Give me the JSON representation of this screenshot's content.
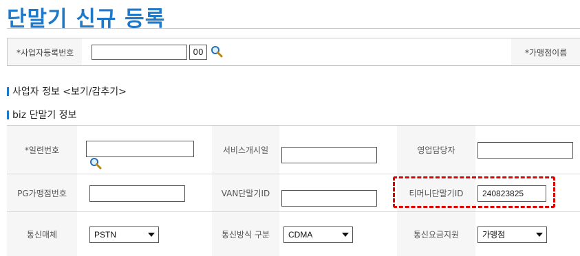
{
  "page": {
    "title": "단말기 신규 등록"
  },
  "search": {
    "biz_no_label": "*사업자등록번호",
    "biz_no_value": "",
    "biz_no_suffix": "00",
    "merchant_name_label": "*가맹점이름"
  },
  "sections": {
    "business_info": "사업자 정보 <보기/감추기>",
    "terminal_info": "biz 단말기 정보"
  },
  "terminal": {
    "serial_no": {
      "label": "*일련번호",
      "value": ""
    },
    "service_start": {
      "label": "서비스개시일",
      "value": ""
    },
    "sales_manager": {
      "label": "영업담당자",
      "value": ""
    },
    "pg_merchant_no": {
      "label": "PG가맹점번호",
      "value": ""
    },
    "van_terminal_id": {
      "label": "VAN단말기ID",
      "value": ""
    },
    "tmoney_terminal_id": {
      "label": "티머니단말기ID",
      "value": "240823825"
    },
    "comm_medium": {
      "label": "통신매체",
      "selected": "PSTN"
    },
    "comm_method": {
      "label": "통신방식 구분",
      "selected": "CDMA"
    },
    "comm_fee_support": {
      "label": "통신요금지원",
      "selected": "가맹점"
    }
  },
  "colors": {
    "title": "#1f78c8",
    "highlight": "#e00000",
    "label_bg": "#f6f6f6"
  },
  "icons": {
    "search": "magnifier-icon"
  }
}
